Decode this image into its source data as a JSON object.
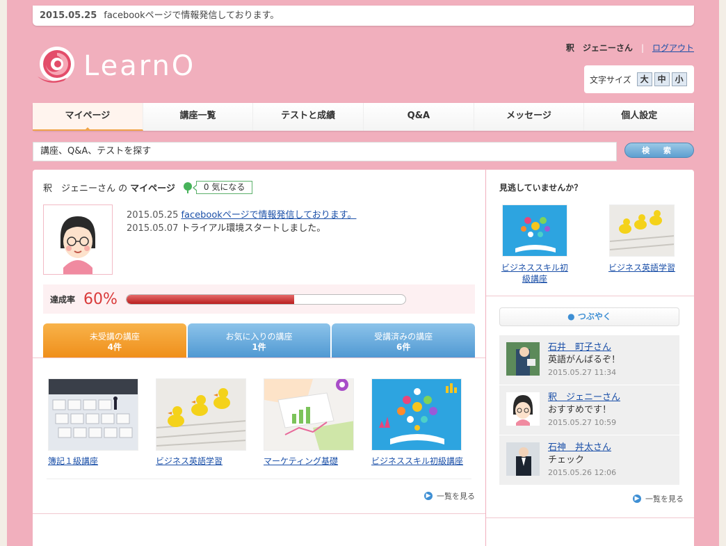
{
  "notice": {
    "date": "2015.05.25",
    "text": "facebookページで情報発信しております。"
  },
  "logo": {
    "text": "LearnO"
  },
  "user": {
    "name": "釈　ジェニーさん",
    "logout": "ログアウト"
  },
  "fontsize": {
    "label": "文字サイズ",
    "large": "大",
    "medium": "中",
    "small": "小"
  },
  "nav": {
    "tabs": [
      "マイページ",
      "講座一覧",
      "テストと成績",
      "Q&A",
      "メッセージ",
      "個人設定"
    ]
  },
  "search": {
    "placeholder": "講座、Q&A、テストを探す",
    "button": "検 索"
  },
  "mypage": {
    "name": "釈　ジェニーさん の",
    "title": "マイページ",
    "likes": "0 気になる",
    "news": [
      {
        "date": "2015.05.25",
        "text": "facebookページで情報発信しております。"
      },
      {
        "date": "2015.05.07",
        "text": "トライアル環境スタートしました。"
      }
    ],
    "progress_label": "達成率",
    "progress_text": "60%",
    "progress_value": 0.6,
    "tabs": [
      {
        "label": "未受講の講座",
        "count": "4件"
      },
      {
        "label": "お気に入りの講座",
        "count": "1件"
      },
      {
        "label": "受講済みの講座",
        "count": "6件"
      }
    ],
    "courses": [
      "簿記１級講座",
      "ビジネス英語学習",
      "マーケティング基礎",
      "ビジネススキル初級講座"
    ],
    "more": "一覧を見る"
  },
  "side": {
    "title": "見逃していませんか？",
    "recommend": [
      "ビジネススキル初級講座",
      "ビジネス英語学習"
    ],
    "tweet": "つぶやく",
    "feed": [
      {
        "name": "石井　町子さん",
        "text": "英語がんばるぞ！",
        "time": "2015.05.27 11:34"
      },
      {
        "name": "釈　ジェニーさん",
        "text": "おすすめです！",
        "time": "2015.05.27 10:59"
      },
      {
        "name": "石神　丼太さん",
        "text": "チェック",
        "time": "2015.05.26 12:06"
      }
    ],
    "more": "一覧を見る"
  },
  "colors": {
    "accent": "#f0a348",
    "frame": "#f1afbd",
    "progress": "#d93a3a",
    "link": "#1a4fa8"
  }
}
